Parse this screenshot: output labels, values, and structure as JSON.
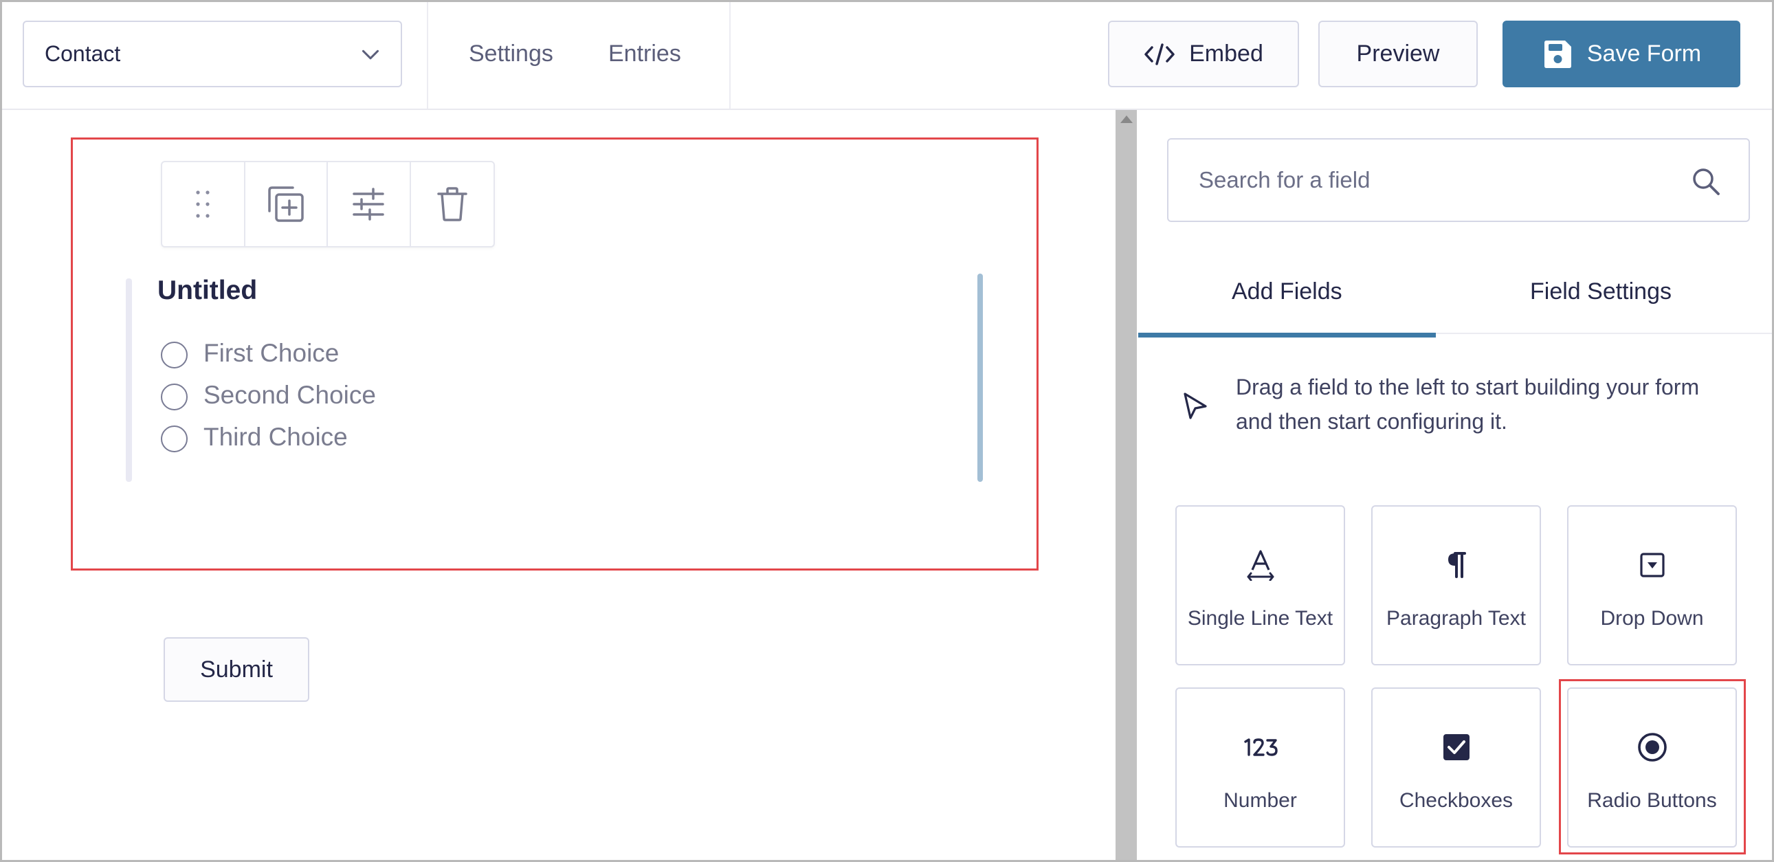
{
  "header": {
    "form_select_value": "Contact",
    "nav_settings": "Settings",
    "nav_entries": "Entries",
    "embed_label": "Embed",
    "preview_label": "Preview",
    "save_label": "Save Form"
  },
  "canvas": {
    "field_title": "Untitled",
    "choices": [
      "First Choice",
      "Second Choice",
      "Third Choice"
    ],
    "submit_label": "Submit",
    "toolbar_icons": [
      "drag-handle-icon",
      "duplicate-icon",
      "settings-sliders-icon",
      "trash-icon"
    ]
  },
  "sidebar": {
    "search_placeholder": "Search for a field",
    "tabs": [
      "Add Fields",
      "Field Settings"
    ],
    "active_tab": "Add Fields",
    "hint": "Drag a field to the left to start building your form and then start configuring it.",
    "fields": [
      {
        "label": "Single Line Text",
        "icon": "text-a-icon"
      },
      {
        "label": "Paragraph Text",
        "icon": "paragraph-icon"
      },
      {
        "label": "Drop Down",
        "icon": "dropdown-icon"
      },
      {
        "label": "Number",
        "icon": "number-123-icon"
      },
      {
        "label": "Checkboxes",
        "icon": "checkbox-icon"
      },
      {
        "label": "Radio Buttons",
        "icon": "radio-button-icon"
      }
    ]
  },
  "colors": {
    "accent": "#3e7aa6",
    "highlight": "#e3464a",
    "text": "#242748"
  }
}
